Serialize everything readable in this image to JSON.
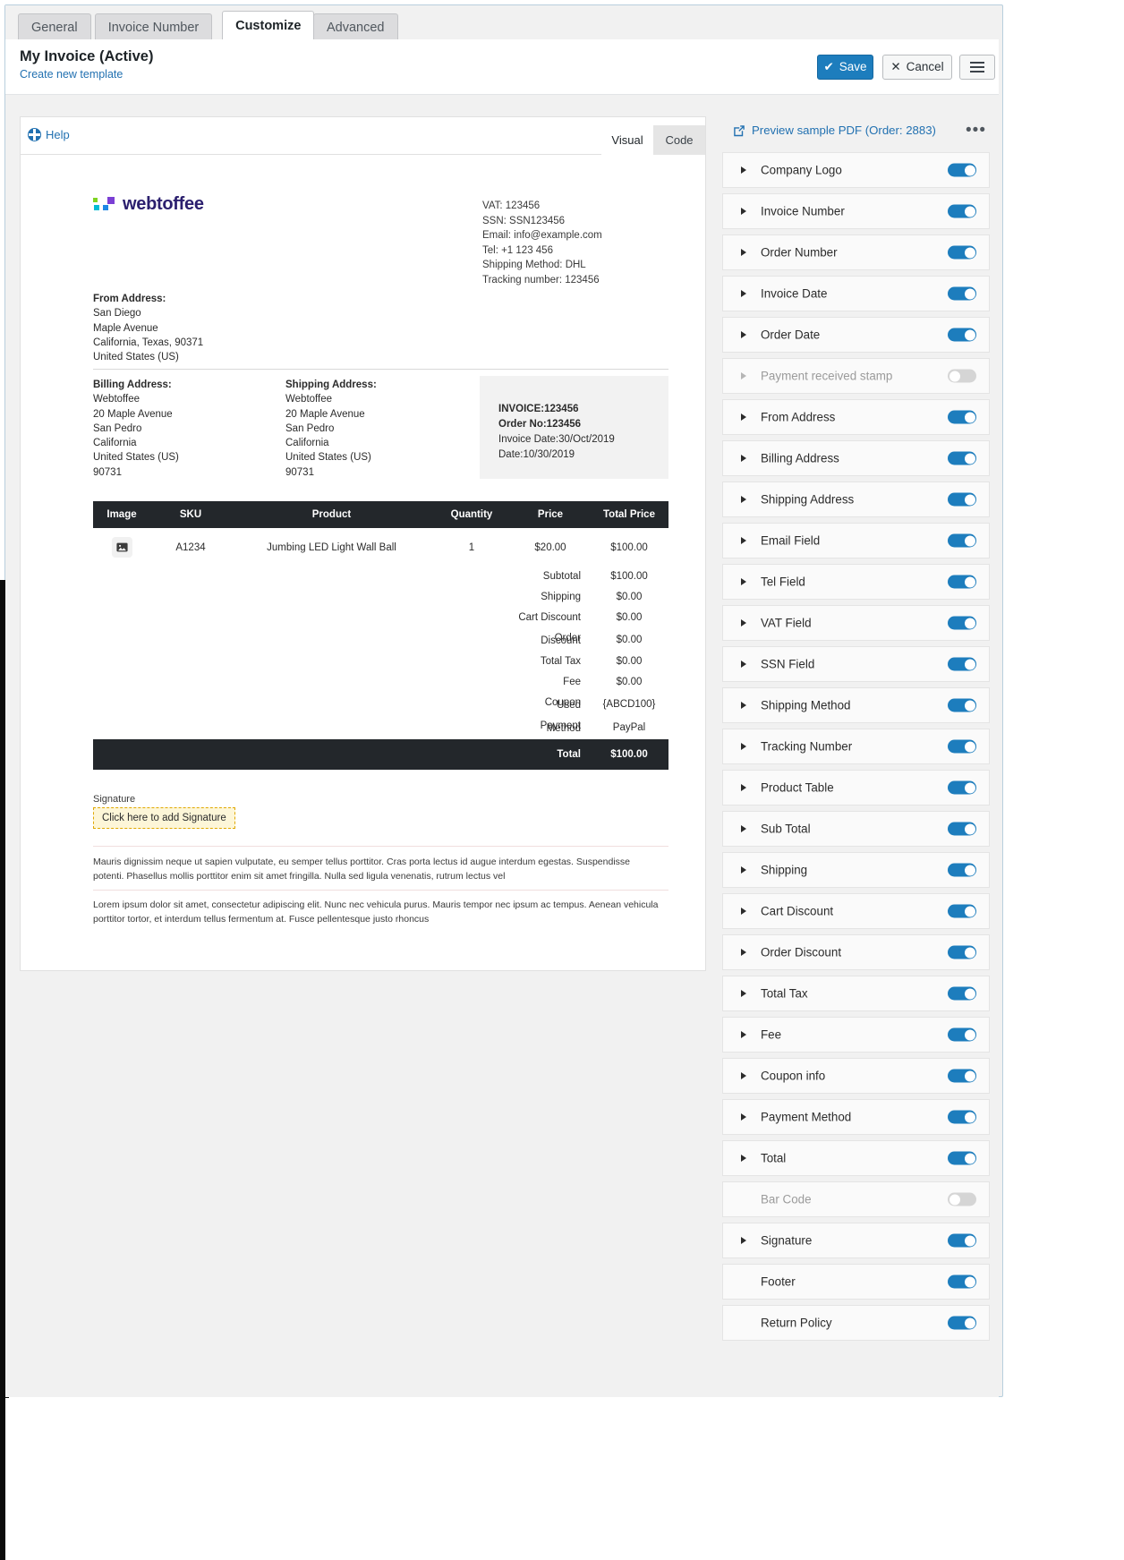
{
  "tabs": [
    {
      "label": "General",
      "active": false
    },
    {
      "label": "Invoice Number",
      "active": false
    },
    {
      "label": "Customize",
      "active": true
    },
    {
      "label": "Advanced",
      "active": false
    }
  ],
  "header": {
    "title": "My Invoice (Active)",
    "create_link": "Create new template",
    "save_label": "Save",
    "cancel_label": "Cancel",
    "menu_icon": "hamburger-icon"
  },
  "editor": {
    "help_label": "Help",
    "help_icon": "help-icon",
    "view_tabs": [
      {
        "label": "Visual",
        "active": true
      },
      {
        "label": "Code",
        "active": false
      }
    ]
  },
  "invoice": {
    "logo_text": "webtoffee",
    "logo_colors": [
      "#7ed321",
      "#00bcd4",
      "#1e88e5",
      "#7b3fd4"
    ],
    "meta": [
      "VAT: 123456",
      "SSN: SSN123456",
      "Email: info@example.com",
      "Tel: +1 123 456",
      "Shipping Method: DHL",
      "Tracking number: 123456"
    ],
    "from_address": {
      "title": "From Address:",
      "lines": [
        "San Diego",
        "Maple Avenue",
        "California, Texas, 90371",
        "United States (US)"
      ]
    },
    "billing_address": {
      "title": "Billing Address:",
      "lines": [
        "Webtoffee",
        "20 Maple Avenue",
        "San Pedro",
        "California",
        "United States (US)",
        "90731"
      ]
    },
    "shipping_address": {
      "title": "Shipping Address:",
      "lines": [
        "Webtoffee",
        "20 Maple Avenue",
        "San Pedro",
        "California",
        "United States (US)",
        "90731"
      ]
    },
    "summary_box": {
      "invoice_no": "INVOICE:123456",
      "order_no": "Order No:123456",
      "invoice_date": "Invoice Date:30/Oct/2019",
      "date": "Date:10/30/2019"
    },
    "table": {
      "headers": [
        "Image",
        "SKU",
        "Product",
        "Quantity",
        "Price",
        "Total Price"
      ],
      "rows": [
        {
          "image": "image-placeholder-icon",
          "sku": "A1234",
          "product": "Jumbing LED Light Wall Ball",
          "quantity": "1",
          "price": "$20.00",
          "total_price": "$100.00"
        }
      ],
      "totals": [
        {
          "label": "Subtotal",
          "value": "$100.00"
        },
        {
          "label": "Shipping",
          "value": "$0.00"
        },
        {
          "label": "Cart Discount",
          "value": "$0.00"
        },
        {
          "label": "Order Discount",
          "value": "$0.00"
        },
        {
          "label": "Total Tax",
          "value": "$0.00"
        },
        {
          "label": "Fee",
          "value": "$0.00"
        },
        {
          "label": "Coupon Used",
          "value": "{ABCD100}"
        },
        {
          "label": "Payment Method",
          "value": "PayPal"
        }
      ],
      "grand_total": {
        "label": "Total",
        "value": "$100.00"
      }
    },
    "signature": {
      "label": "Signature",
      "placeholder": "Click here to add Signature"
    },
    "footer_texts": [
      "Mauris dignissim neque ut sapien vulputate, eu semper tellus porttitor. Cras porta lectus id augue interdum egestas. Suspendisse potenti. Phasellus mollis porttitor enim sit amet fringilla. Nulla sed ligula venenatis, rutrum lectus vel",
      "Lorem ipsum dolor sit amet, consectetur adipiscing elit. Nunc nec vehicula purus. Mauris tempor nec ipsum ac tempus. Aenean vehicula porttitor tortor, et interdum tellus fermentum at. Fusce pellentesque justo rhoncus"
    ]
  },
  "right_panel": {
    "preview_label": "Preview sample PDF (Order: 2883)",
    "preview_icon": "external-link-icon",
    "more_icon": "ellipsis-icon",
    "elements": [
      {
        "label": "Company Logo",
        "enabled": true,
        "expandable": true
      },
      {
        "label": "Invoice Number",
        "enabled": true,
        "expandable": true
      },
      {
        "label": "Order Number",
        "enabled": true,
        "expandable": true
      },
      {
        "label": "Invoice Date",
        "enabled": true,
        "expandable": true
      },
      {
        "label": "Order Date",
        "enabled": true,
        "expandable": true
      },
      {
        "label": "Payment received stamp",
        "enabled": false,
        "expandable": true
      },
      {
        "label": "From Address",
        "enabled": true,
        "expandable": true
      },
      {
        "label": "Billing Address",
        "enabled": true,
        "expandable": true
      },
      {
        "label": "Shipping Address",
        "enabled": true,
        "expandable": true
      },
      {
        "label": "Email Field",
        "enabled": true,
        "expandable": true
      },
      {
        "label": "Tel Field",
        "enabled": true,
        "expandable": true
      },
      {
        "label": "VAT Field",
        "enabled": true,
        "expandable": true
      },
      {
        "label": "SSN Field",
        "enabled": true,
        "expandable": true
      },
      {
        "label": "Shipping Method",
        "enabled": true,
        "expandable": true
      },
      {
        "label": "Tracking Number",
        "enabled": true,
        "expandable": true
      },
      {
        "label": "Product Table",
        "enabled": true,
        "expandable": true
      },
      {
        "label": "Sub Total",
        "enabled": true,
        "expandable": true
      },
      {
        "label": "Shipping",
        "enabled": true,
        "expandable": true
      },
      {
        "label": "Cart Discount",
        "enabled": true,
        "expandable": true
      },
      {
        "label": "Order Discount",
        "enabled": true,
        "expandable": true
      },
      {
        "label": "Total Tax",
        "enabled": true,
        "expandable": true
      },
      {
        "label": "Fee",
        "enabled": true,
        "expandable": true
      },
      {
        "label": "Coupon info",
        "enabled": true,
        "expandable": true
      },
      {
        "label": "Payment Method",
        "enabled": true,
        "expandable": true
      },
      {
        "label": "Total",
        "enabled": true,
        "expandable": true
      },
      {
        "label": "Bar Code",
        "enabled": false,
        "expandable": false
      },
      {
        "label": "Signature",
        "enabled": true,
        "expandable": true
      },
      {
        "label": "Footer",
        "enabled": true,
        "expandable": false
      },
      {
        "label": "Return Policy",
        "enabled": true,
        "expandable": false
      }
    ]
  },
  "colors": {
    "accent": "#1d7dbd",
    "link": "#2271b1",
    "table_header": "#23272b",
    "signature_border": "#e0a800",
    "signature_bg": "#fdf6d8"
  }
}
